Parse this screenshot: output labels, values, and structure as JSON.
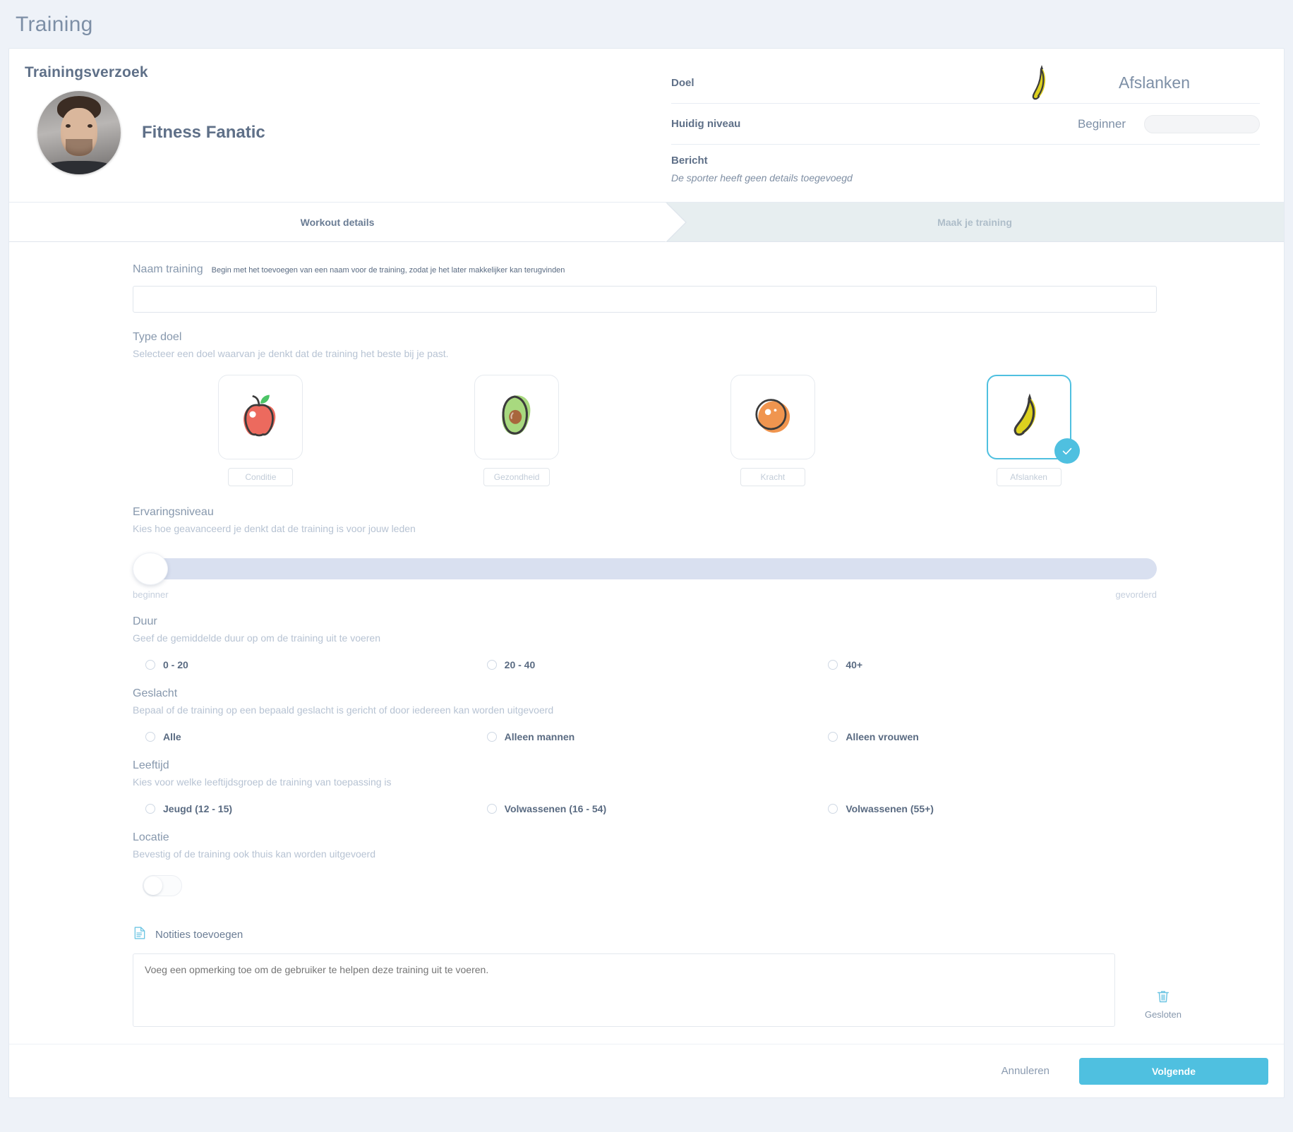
{
  "page": {
    "title": "Training"
  },
  "request": {
    "heading": "Trainingsverzoek",
    "athlete_name": "Fitness Fanatic"
  },
  "info": {
    "goal_label": "Doel",
    "goal_value": "Afslanken",
    "goal_icon": "banana-icon",
    "level_label": "Huidig niveau",
    "level_value": "Beginner",
    "message_label": "Bericht",
    "message_text": "De sporter heeft geen details toegevoegd"
  },
  "tabs": [
    {
      "label": "Workout details",
      "active": true
    },
    {
      "label": "Maak je training",
      "active": false
    }
  ],
  "form": {
    "name": {
      "label": "Naam training",
      "hint": "Begin met het toevoegen van een naam voor de training, zodat je het later makkelijker kan terugvinden",
      "value": "",
      "placeholder": ""
    },
    "goal_type": {
      "label": "Type doel",
      "sub": "Selecteer een doel waarvan je denkt dat de training het beste bij je past.",
      "options": [
        {
          "label": "Conditie",
          "icon": "apple-icon",
          "selected": false
        },
        {
          "label": "Gezondheid",
          "icon": "avocado-icon",
          "selected": false
        },
        {
          "label": "Kracht",
          "icon": "orange-icon",
          "selected": false
        },
        {
          "label": "Afslanken",
          "icon": "banana-icon",
          "selected": true
        }
      ]
    },
    "experience": {
      "label": "Ervaringsniveau",
      "sub": "Kies hoe geavanceerd je denkt dat de training is voor jouw leden",
      "min_label": "beginner",
      "max_label": "gevorderd",
      "value_percent": 0
    },
    "duration": {
      "label": "Duur",
      "sub": "Geef de gemiddelde duur op om de training uit te voeren",
      "options": [
        {
          "label": "0 - 20",
          "selected": false
        },
        {
          "label": "20 - 40",
          "selected": false
        },
        {
          "label": "40+",
          "selected": false
        }
      ]
    },
    "gender": {
      "label": "Geslacht",
      "sub": "Bepaal of de training op een bepaald geslacht is gericht of door iedereen kan worden uitgevoerd",
      "options": [
        {
          "label": "Alle",
          "selected": false
        },
        {
          "label": "Alleen mannen",
          "selected": false
        },
        {
          "label": "Alleen vrouwen",
          "selected": false
        }
      ]
    },
    "age": {
      "label": "Leeftijd",
      "sub": "Kies voor welke leeftijdsgroep de training van toepassing is",
      "options": [
        {
          "label": "Jeugd (12 - 15)",
          "selected": false
        },
        {
          "label": "Volwassenen (16 - 54)",
          "selected": false
        },
        {
          "label": "Volwassenen (55+)",
          "selected": false
        }
      ]
    },
    "location": {
      "label": "Locatie",
      "sub": "Bevestig of de training ook thuis kan worden uitgevoerd",
      "enabled": false
    },
    "notes": {
      "label": "Notities toevoegen",
      "icon": "document-icon",
      "placeholder": "Voeg een opmerking toe om de gebruiker te helpen deze training uit te voeren.",
      "value": "",
      "delete_icon": "trash-icon",
      "delete_label": "Gesloten"
    }
  },
  "footer": {
    "cancel_label": "Annuleren",
    "next_label": "Volgende"
  },
  "colors": {
    "accent": "#4fc0e0",
    "page_bg": "#eef2f8",
    "text": "#5a6b82",
    "muted": "#b7c3d3",
    "slider_track": "#d9e0f0",
    "tab_inactive_bg": "#e7eef0",
    "apple": "#ec6a5e",
    "avocado": "#a8d97f",
    "orange": "#f0954f",
    "banana": "#ddd11f"
  }
}
